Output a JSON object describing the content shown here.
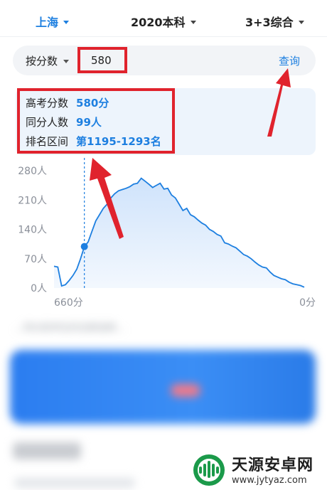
{
  "filters": [
    {
      "label": "上海",
      "active": true
    },
    {
      "label": "2020本科",
      "active": false
    },
    {
      "label": "3+3综合",
      "active": false
    }
  ],
  "search": {
    "mode_label": "按分数",
    "score_value": "580",
    "query_label": "查询"
  },
  "result": {
    "rows": [
      {
        "key": "高考分数",
        "value": "580分"
      },
      {
        "key": "同分人数",
        "value": "99人"
      },
      {
        "key": "排名区间",
        "value": "第1195-1293名"
      }
    ]
  },
  "chart_data": {
    "type": "area",
    "title": "",
    "xlabel": "",
    "ylabel": "",
    "x_tick_labels": {
      "start": "660分",
      "end": "0分"
    },
    "xlim": [
      660,
      0
    ],
    "ylim": [
      0,
      280
    ],
    "y_ticks": [
      "0人",
      "70人",
      "140人",
      "210人",
      "280人"
    ],
    "y_tick_values": [
      0,
      70,
      140,
      210,
      280
    ],
    "highlight": {
      "x": 580,
      "y": 99
    },
    "series": [
      {
        "x": [
          660,
          650,
          640,
          630,
          620,
          610,
          600,
          590,
          580,
          570,
          560,
          550,
          540,
          530,
          520,
          510,
          500,
          490,
          480,
          470,
          460,
          450,
          440,
          430,
          420,
          410,
          400,
          390,
          380,
          370,
          360,
          350,
          340,
          330,
          320,
          310,
          300,
          290,
          280,
          270,
          260,
          250,
          240,
          230,
          220,
          210,
          200,
          190,
          180,
          170,
          160,
          150,
          140,
          130,
          120,
          110,
          100,
          90,
          80,
          70,
          60,
          50,
          40,
          30,
          20,
          10,
          0
        ],
        "values": [
          52,
          50,
          5,
          8,
          18,
          30,
          45,
          70,
          99,
          110,
          135,
          160,
          175,
          190,
          200,
          215,
          225,
          232,
          235,
          238,
          242,
          248,
          250,
          262,
          255,
          248,
          240,
          245,
          250,
          236,
          238,
          222,
          215,
          200,
          185,
          190,
          175,
          170,
          162,
          155,
          150,
          140,
          135,
          128,
          124,
          108,
          105,
          100,
          96,
          88,
          80,
          76,
          70,
          62,
          55,
          50,
          48,
          38,
          30,
          26,
          22,
          20,
          14,
          10,
          8,
          6,
          2
        ]
      }
    ],
    "colors": {
      "line": "#1d7fe0",
      "fill_top": "#cfe3fb",
      "fill_bottom": "#f3f8fe",
      "marker": "#1d7fe0",
      "guide": "#1d7fe0"
    }
  },
  "blurred": {
    "line": "…同分段考生的志愿选择…"
  },
  "watermark": {
    "name": "天源安卓网",
    "url": "www.jytyaz.com"
  },
  "colors": {
    "accent": "#1d7fe0",
    "annotation_red": "#e0232d",
    "panel_bg": "#edf4fc"
  }
}
